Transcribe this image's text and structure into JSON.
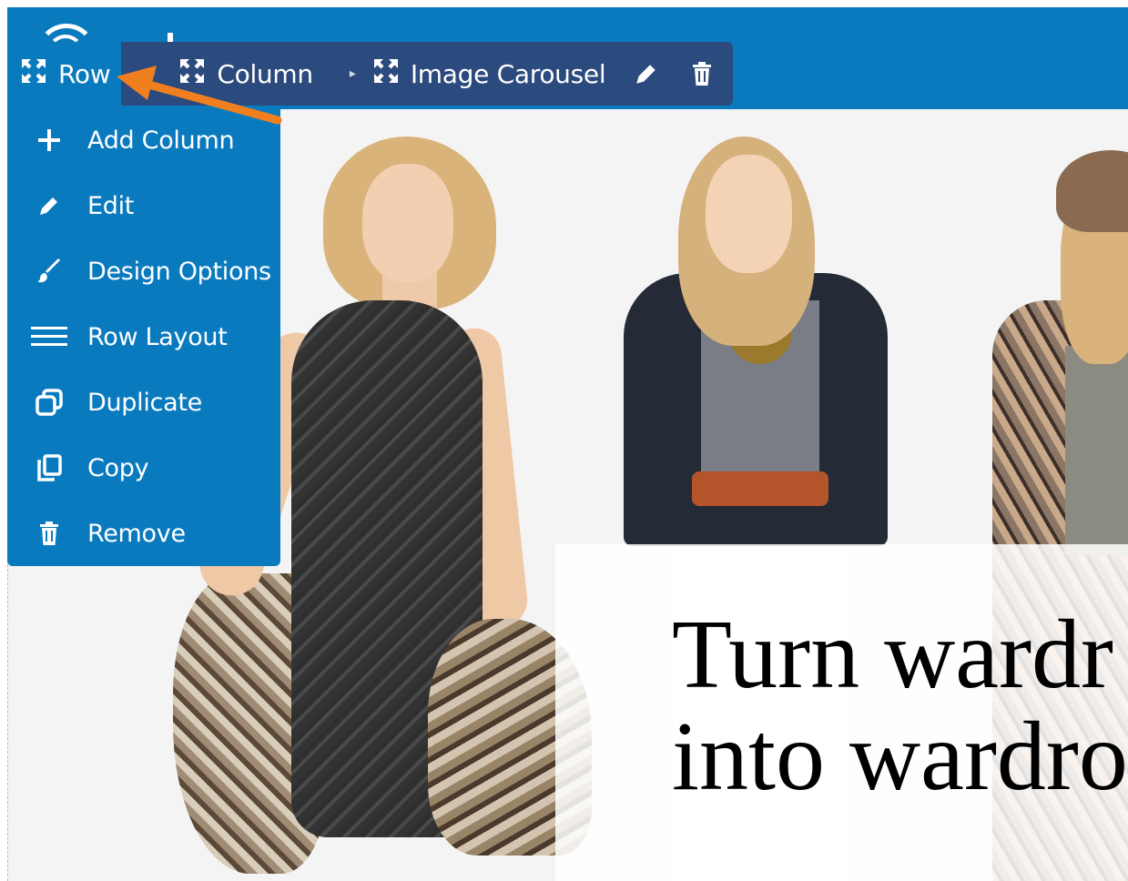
{
  "breadcrumb": {
    "items": [
      {
        "label": "Row",
        "icon": "move-arrows-icon"
      },
      {
        "label": "Column",
        "icon": "move-arrows-icon"
      },
      {
        "label": "Image Carousel",
        "icon": "move-arrows-icon"
      }
    ],
    "tools": [
      "pencil-icon",
      "trash-icon"
    ]
  },
  "menu": {
    "items": [
      {
        "label": "Add Column",
        "icon": "plus-icon"
      },
      {
        "label": "Edit",
        "icon": "pencil-icon"
      },
      {
        "label": "Design Options",
        "icon": "paintbrush-icon"
      },
      {
        "label": "Row Layout",
        "icon": "layout-lines-icon"
      },
      {
        "label": "Duplicate",
        "icon": "duplicate-icon"
      },
      {
        "label": "Copy",
        "icon": "copy-icon"
      },
      {
        "label": "Remove",
        "icon": "trash-icon"
      }
    ]
  },
  "hero": {
    "line1": "Turn wardr",
    "line2": "into wardro"
  },
  "colors": {
    "toolbar_blue": "#0a7abf",
    "breadcrumb_navy": "#2b4a7e",
    "annotation_arrow": "#f07f1f"
  }
}
